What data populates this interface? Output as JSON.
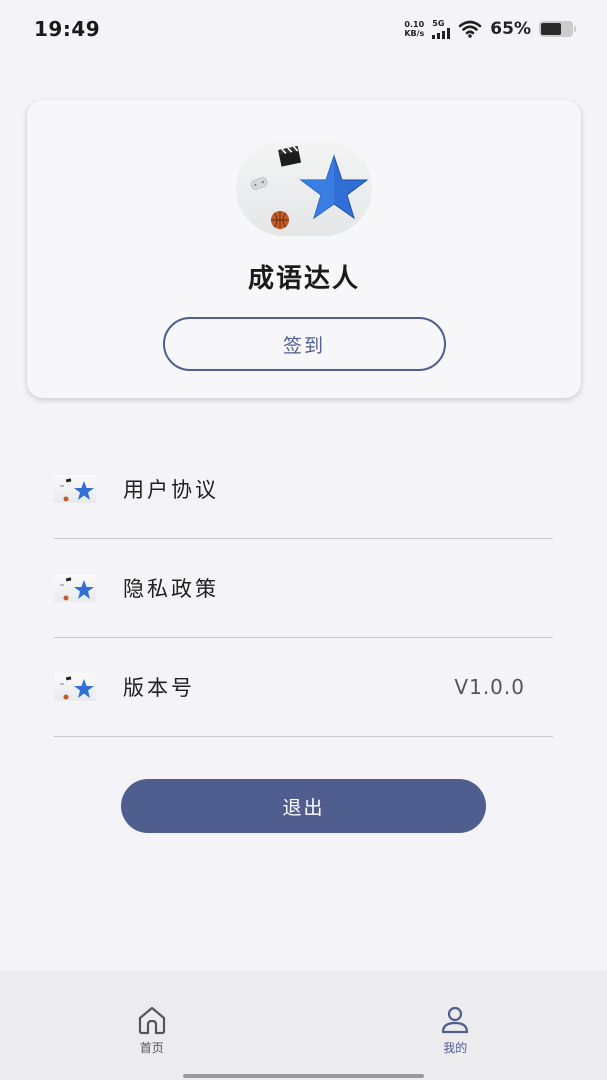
{
  "status_bar": {
    "time": "19:49",
    "net_speed_value": "0.10",
    "net_speed_unit": "KB/s",
    "network_type": "5G",
    "battery_percent": "65%",
    "battery_level": 0.65
  },
  "profile": {
    "app_name": "成语达人",
    "checkin_label": "签到"
  },
  "menu": {
    "items": [
      {
        "label": "用户协议",
        "value": ""
      },
      {
        "label": "隐私政策",
        "value": ""
      },
      {
        "label": "版本号",
        "value": "V1.0.0"
      }
    ]
  },
  "logout_label": "退出",
  "bottom_nav": {
    "home_label": "首页",
    "mine_label": "我的",
    "active": "mine"
  },
  "colors": {
    "accent": "#4f5d8f",
    "background": "#f4f4f8",
    "star": "#2f6fd6"
  }
}
